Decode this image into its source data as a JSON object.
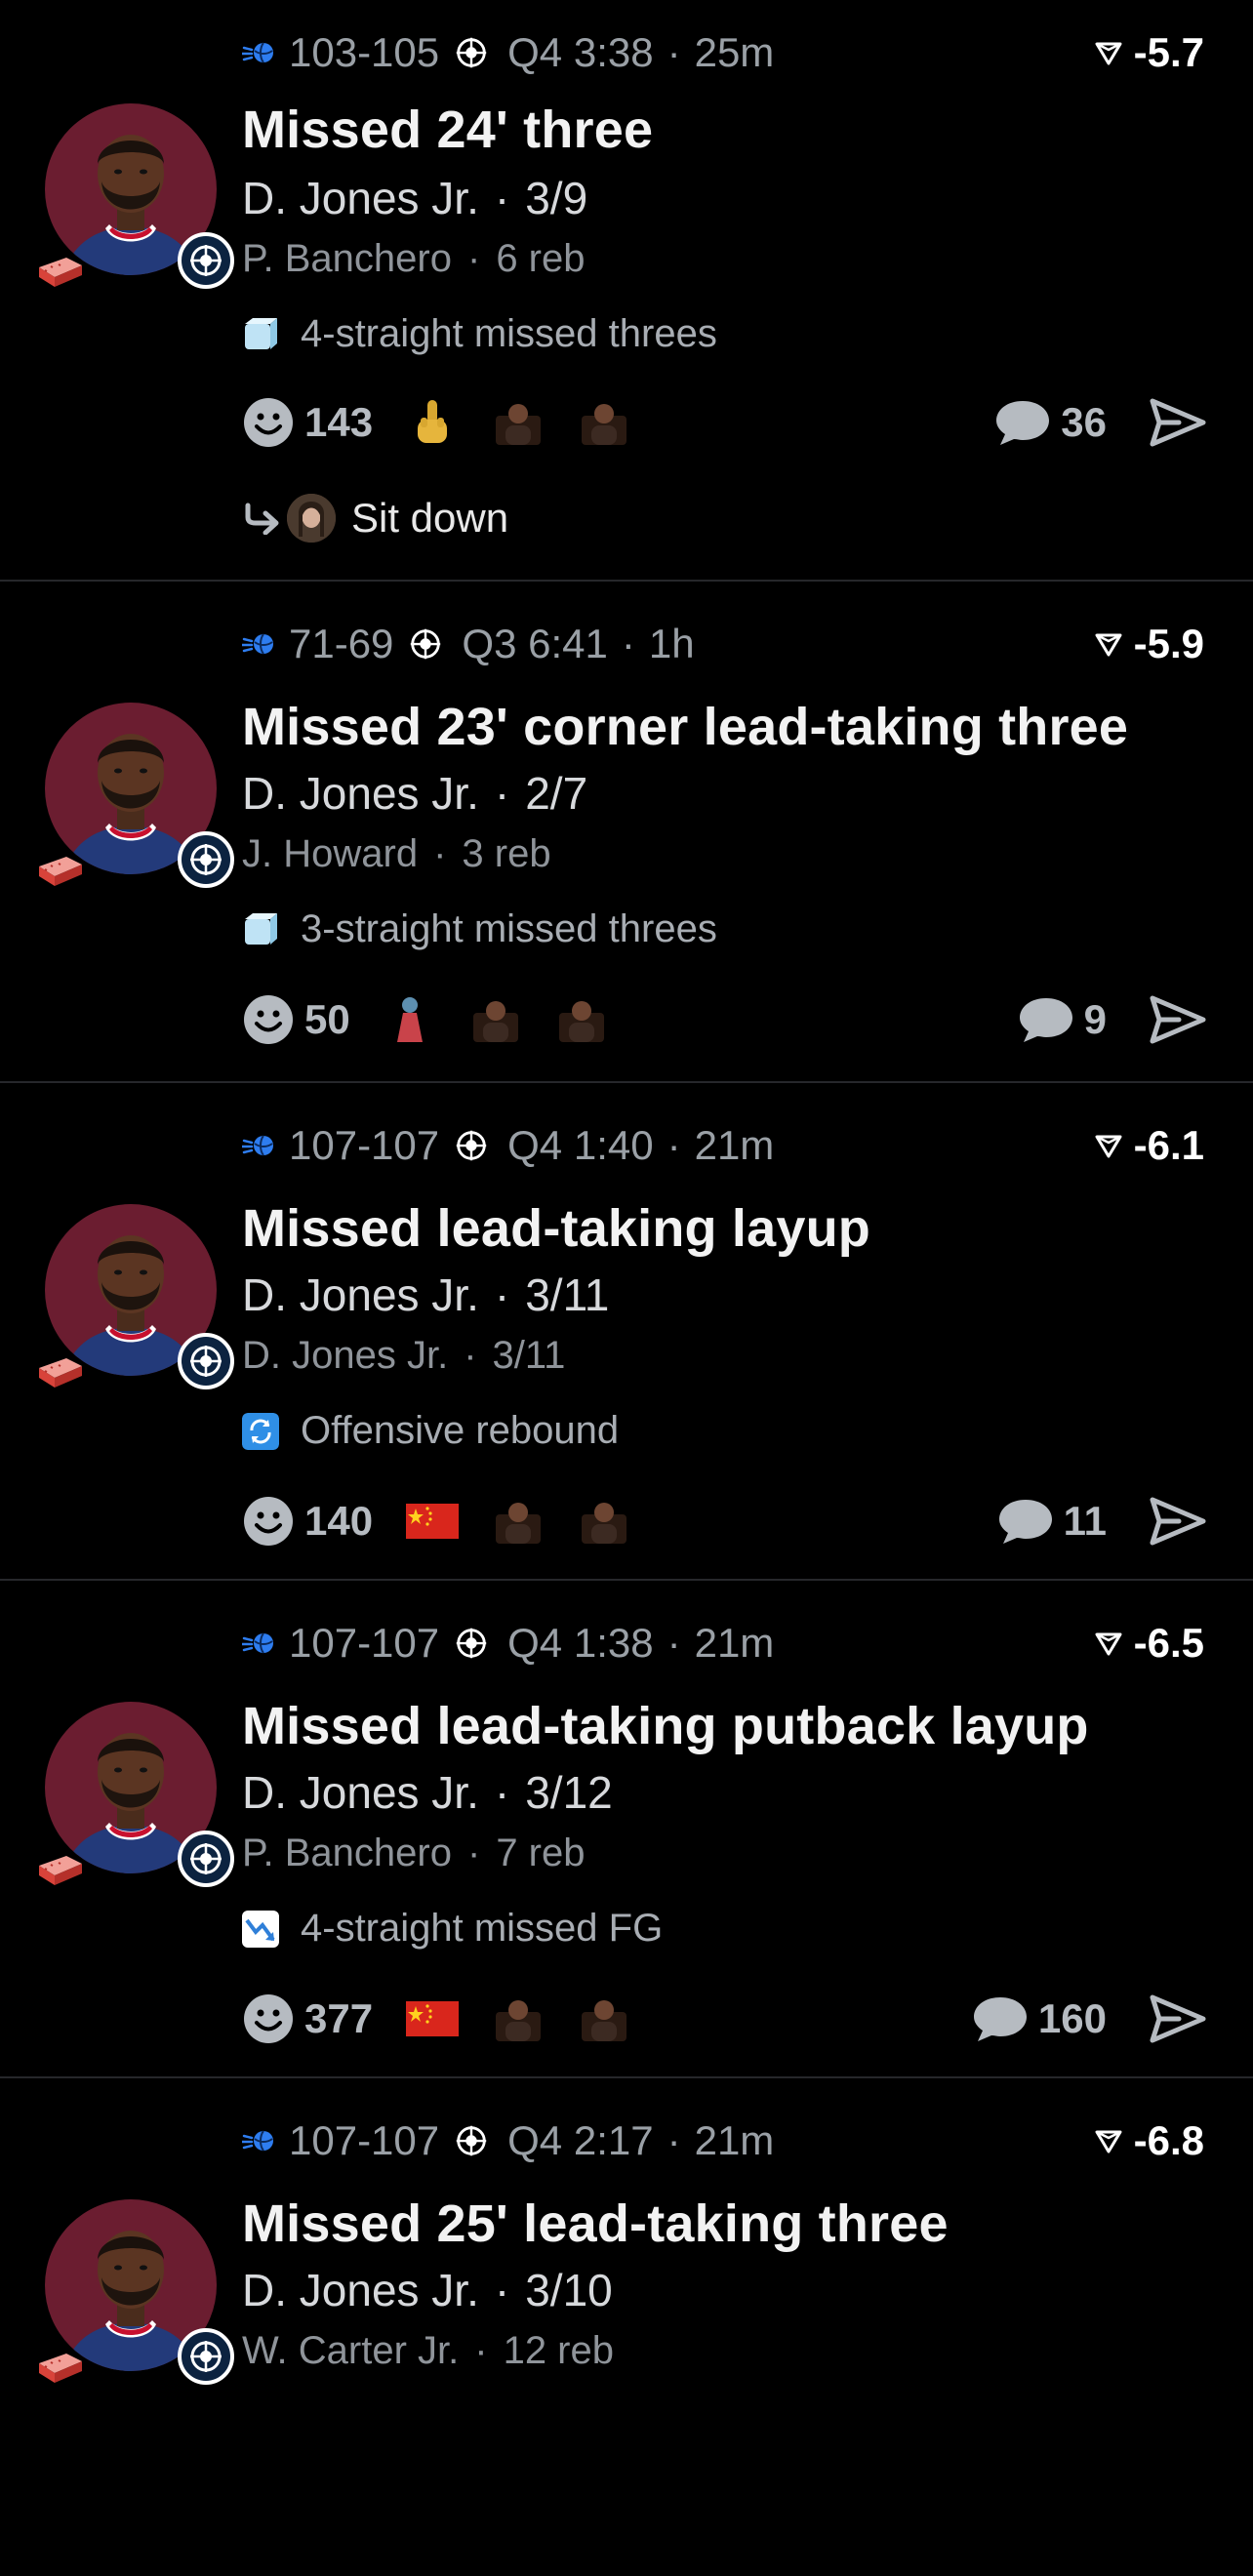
{
  "colors": {
    "background": "#000000",
    "avatar_bg": "#6b1d30",
    "team_blue": "#0c2340",
    "muted_text": "#9aa0a6",
    "ball_blue": "#2e7df0"
  },
  "posts": [
    {
      "score": "103-105",
      "quarter": "Q4 3:38",
      "ago": "25m",
      "value": "-5.7",
      "title": "Missed 24' three",
      "player": "D. Jones Jr.",
      "player_stat": "3/9",
      "other": "P. Banchero",
      "other_stat": "6 reb",
      "tag_icon": "ice-cube-icon",
      "tag": "4-straight missed threes",
      "reactions": "143",
      "reactors": [
        "middle-finger-emoji",
        "reaction-gif",
        "reaction-gif"
      ],
      "comments": "36",
      "reply": "Sit down"
    },
    {
      "score": "71-69",
      "quarter": "Q3 6:41",
      "ago": "1h",
      "value": "-5.9",
      "title": "Missed 23' corner lead-taking three",
      "player": "D. Jones Jr.",
      "player_stat": "2/7",
      "other": "J. Howard",
      "other_stat": "3 reb",
      "tag_icon": "ice-cube-icon",
      "tag": "3-straight missed threes",
      "reactions": "50",
      "reactors": [
        "reaction-sticker",
        "reaction-gif",
        "reaction-gif"
      ],
      "comments": "9"
    },
    {
      "score": "107-107",
      "quarter": "Q4 1:40",
      "ago": "21m",
      "value": "-6.1",
      "title": "Missed lead-taking layup",
      "player": "D. Jones Jr.",
      "player_stat": "3/11",
      "other": "D. Jones Jr.",
      "other_stat": "3/11",
      "tag_icon": "repeat-icon",
      "tag": "Offensive rebound",
      "reactions": "140",
      "reactors": [
        "china-flag-emoji",
        "reaction-gif",
        "reaction-gif"
      ],
      "comments": "11"
    },
    {
      "score": "107-107",
      "quarter": "Q4 1:38",
      "ago": "21m",
      "value": "-6.5",
      "title": "Missed lead-taking putback layup",
      "player": "D. Jones Jr.",
      "player_stat": "3/12",
      "other": "P. Banchero",
      "other_stat": "7 reb",
      "tag_icon": "chart-down-icon",
      "tag": "4-straight missed FG",
      "reactions": "377",
      "reactors": [
        "china-flag-emoji",
        "reaction-gif",
        "reaction-gif"
      ],
      "comments": "160"
    },
    {
      "score": "107-107",
      "quarter": "Q4 2:17",
      "ago": "21m",
      "value": "-6.8",
      "title": "Missed 25' lead-taking three",
      "player": "D. Jones Jr.",
      "player_stat": "3/10",
      "other": "W. Carter Jr.",
      "other_stat": "12 reb"
    }
  ]
}
